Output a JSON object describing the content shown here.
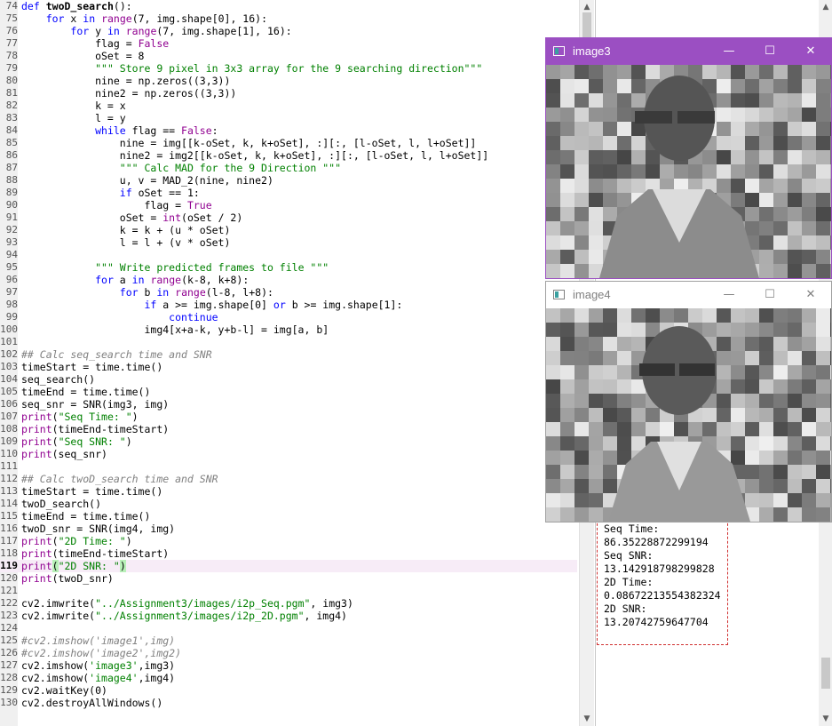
{
  "editor": {
    "current_line": "119",
    "lines": [
      {
        "n": "74",
        "h": "<span class=\"k\">def</span> <span class=\"d\">twoD_search</span>():"
      },
      {
        "n": "75",
        "h": "    <span class=\"k\">for</span> x <span class=\"k\">in</span> <span class=\"b\">range</span>(7, img.shape[0], 16):"
      },
      {
        "n": "76",
        "h": "        <span class=\"k\">for</span> y <span class=\"k\">in</span> <span class=\"b\">range</span>(7, img.shape[1], 16):"
      },
      {
        "n": "77",
        "h": "            flag = <span class=\"b\">False</span>"
      },
      {
        "n": "78",
        "h": "            oSet = 8"
      },
      {
        "n": "79",
        "h": "            <span class=\"s\">\"\"\" Store 9 pixel in 3x3 array for the 9 searching direction\"\"\"</span>"
      },
      {
        "n": "80",
        "h": "            nine = np.zeros((3,3))"
      },
      {
        "n": "81",
        "h": "            nine2 = np.zeros((3,3))"
      },
      {
        "n": "82",
        "h": "            k = x"
      },
      {
        "n": "83",
        "h": "            l = y"
      },
      {
        "n": "84",
        "h": "            <span class=\"k\">while</span> flag == <span class=\"b\">False</span>:"
      },
      {
        "n": "85",
        "h": "                nine = img[[k-oSet, k, k+oSet], :][:, [l-oSet, l, l+oSet]]"
      },
      {
        "n": "86",
        "h": "                nine2 = img2[[k-oSet, k, k+oSet], :][:, [l-oSet, l, l+oSet]]"
      },
      {
        "n": "87",
        "h": "                <span class=\"s\">\"\"\" Calc MAD for the 9 Direction \"\"\"</span>"
      },
      {
        "n": "88",
        "h": "                u, v = MAD_2(nine, nine2)"
      },
      {
        "n": "89",
        "h": "                <span class=\"k\">if</span> oSet == 1:"
      },
      {
        "n": "90",
        "h": "                    flag = <span class=\"b\">True</span>"
      },
      {
        "n": "91",
        "h": "                oSet = <span class=\"b\">int</span>(oSet / 2)"
      },
      {
        "n": "92",
        "h": "                k = k + (u * oSet)"
      },
      {
        "n": "93",
        "h": "                l = l + (v * oSet)"
      },
      {
        "n": "94",
        "h": ""
      },
      {
        "n": "95",
        "h": "            <span class=\"s\">\"\"\" Write predicted frames to file \"\"\"</span>"
      },
      {
        "n": "96",
        "h": "            <span class=\"k\">for</span> a <span class=\"k\">in</span> <span class=\"b\">range</span>(k-8, k+8):"
      },
      {
        "n": "97",
        "h": "                <span class=\"k\">for</span> b <span class=\"k\">in</span> <span class=\"b\">range</span>(l-8, l+8):"
      },
      {
        "n": "98",
        "h": "                    <span class=\"k\">if</span> a >= img.shape[0] <span class=\"k\">or</span> b >= img.shape[1]:"
      },
      {
        "n": "99",
        "h": "                        <span class=\"k\">continue</span>"
      },
      {
        "n": "100",
        "h": "                    img4[x+a-k, y+b-l] = img[a, b]"
      },
      {
        "n": "101",
        "h": ""
      },
      {
        "n": "102",
        "h": "<span class=\"c\">## Calc seq_search time and SNR</span>"
      },
      {
        "n": "103",
        "h": "timeStart = time.time()"
      },
      {
        "n": "104",
        "h": "seq_search()"
      },
      {
        "n": "105",
        "h": "timeEnd = time.time()"
      },
      {
        "n": "106",
        "h": "seq_snr = SNR(img3, img)"
      },
      {
        "n": "107",
        "h": "<span class=\"b\">print</span>(<span class=\"s\">\"Seq Time: \"</span>)"
      },
      {
        "n": "108",
        "h": "<span class=\"b\">print</span>(timeEnd-timeStart)"
      },
      {
        "n": "109",
        "h": "<span class=\"b\">print</span>(<span class=\"s\">\"Seq SNR: \"</span>)"
      },
      {
        "n": "110",
        "h": "<span class=\"b\">print</span>(seq_snr)"
      },
      {
        "n": "111",
        "h": ""
      },
      {
        "n": "112",
        "h": "<span class=\"c\">## Calc twoD_search time and SNR</span>"
      },
      {
        "n": "113",
        "h": "timeStart = time.time()"
      },
      {
        "n": "114",
        "h": "twoD_search()"
      },
      {
        "n": "115",
        "h": "timeEnd = time.time()"
      },
      {
        "n": "116",
        "h": "twoD_snr = SNR(img4, img)"
      },
      {
        "n": "117",
        "h": "<span class=\"b\">print</span>(<span class=\"s\">\"2D Time: \"</span>)"
      },
      {
        "n": "118",
        "h": "<span class=\"b\">print</span>(timeEnd-timeStart)"
      },
      {
        "n": "119",
        "h": "<span class=\"b\">print</span><span class=\"br\">(</span><span class=\"s\">\"2D SNR: \"</span><span class=\"br\">)</span>"
      },
      {
        "n": "120",
        "h": "<span class=\"b\">print</span>(twoD_snr)"
      },
      {
        "n": "121",
        "h": ""
      },
      {
        "n": "122",
        "h": "cv2.imwrite(<span class=\"s\">\"../Assignment3/images/i2p_Seq.pgm\"</span>, img3)"
      },
      {
        "n": "123",
        "h": "cv2.imwrite(<span class=\"s\">\"../Assignment3/images/i2p_2D.pgm\"</span>, img4)"
      },
      {
        "n": "124",
        "h": ""
      },
      {
        "n": "125",
        "h": "<span class=\"c\">#cv2.imshow('image1',img)</span>"
      },
      {
        "n": "126",
        "h": "<span class=\"c\">#cv2.imshow('image2',img2)</span>"
      },
      {
        "n": "127",
        "h": "cv2.imshow(<span class=\"s\">'image3'</span>,img3)"
      },
      {
        "n": "128",
        "h": "cv2.imshow(<span class=\"s\">'image4'</span>,img4)"
      },
      {
        "n": "129",
        "h": "cv2.waitKey(0)"
      },
      {
        "n": "130",
        "h": "cv2.destroyAllWindows()"
      }
    ]
  },
  "output": {
    "lines": [
      "Seq Time:",
      "86.35228872299194",
      "Seq SNR:",
      "13.142918798299828",
      "2D Time:",
      "0.08672213554382324",
      "2D SNR:",
      "13.20742759647704"
    ]
  },
  "windows": {
    "image3": {
      "title": "image3",
      "active": true,
      "accent": "#9b4fc2"
    },
    "image4": {
      "title": "image4",
      "active": false
    }
  },
  "icons": {
    "minimize": "minimize-icon",
    "maximize": "maximize-icon",
    "close": "close-icon",
    "scroll_up": "scroll-up-arrow-icon",
    "scroll_down": "scroll-down-arrow-icon"
  }
}
